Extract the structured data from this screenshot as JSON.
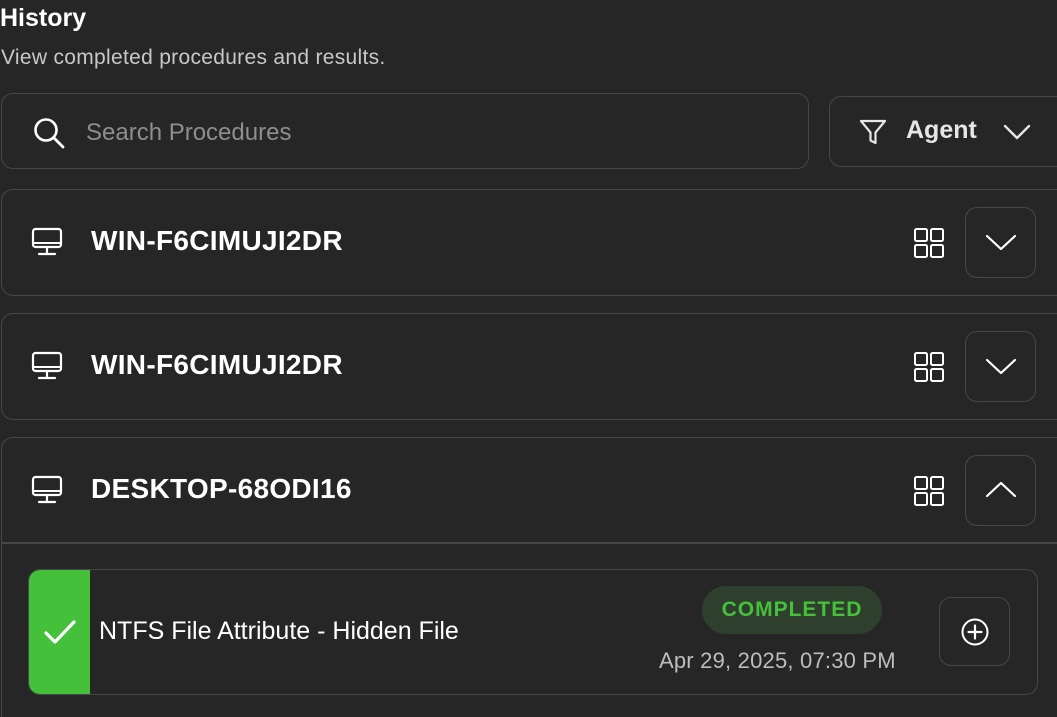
{
  "header": {
    "title": "History",
    "subtitle": "View completed procedures and results."
  },
  "search": {
    "placeholder": "Search Procedures",
    "value": "",
    "icon": "search-icon"
  },
  "filter": {
    "label": "Agent",
    "icon": "filter-icon"
  },
  "agents": [
    {
      "name": "WIN-F6CIMUJI2DR",
      "expanded": false
    },
    {
      "name": "WIN-F6CIMUJI2DR",
      "expanded": false
    },
    {
      "name": "DESKTOP-68ODI16",
      "expanded": true
    }
  ],
  "procedure": {
    "name": "NTFS File Attribute - Hidden File",
    "status": "COMPLETED",
    "date": "Apr 29, 2025, 07:30 PM"
  },
  "colors": {
    "background": "#262626",
    "border": "#474747",
    "success": "#45c03b",
    "badge_bg": "#2f3f2e",
    "muted_text": "#bdbdbd"
  }
}
